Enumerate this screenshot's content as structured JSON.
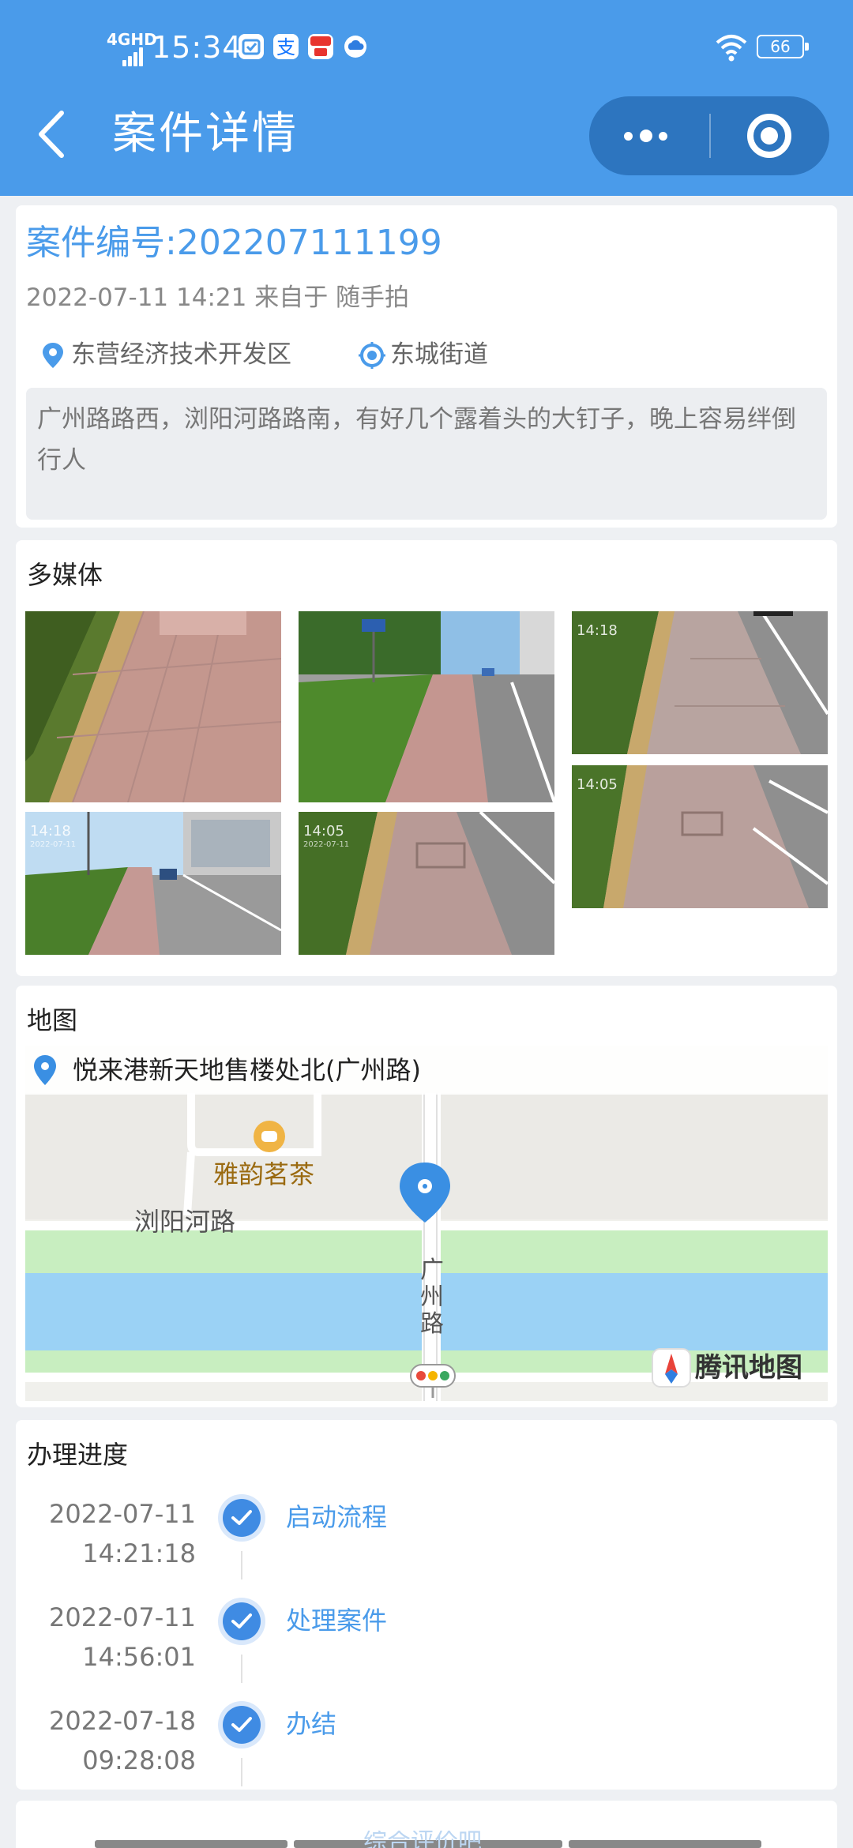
{
  "status_bar": {
    "network": "4GHD",
    "time": "15:34",
    "battery": "66"
  },
  "header": {
    "title": "案件详情"
  },
  "case": {
    "number_label": "案件编号:202207111199",
    "meta": "2022-07-11 14:21 来自于 随手拍",
    "district": "东营经济技术开发区",
    "street": "东城街道",
    "description": "广州路路西，浏阳河路路南，有好几个露着头的大钉子，晚上容易绊倒行人"
  },
  "media": {
    "title": "多媒体",
    "photos": [
      {
        "timestamp": "",
        "date": ""
      },
      {
        "timestamp": "",
        "date": ""
      },
      {
        "timestamp": "14:18",
        "date": ""
      },
      {
        "timestamp": "14:05",
        "date": ""
      },
      {
        "timestamp": "14:18",
        "date": "2022-07-11"
      },
      {
        "timestamp": "14:05",
        "date": "2022-07-11"
      }
    ]
  },
  "map": {
    "title": "地图",
    "address": "悦来港新天地售楼处北(广州路)",
    "poi_teahouse": "雅韵茗茶",
    "road_liuyanghe": "浏阳河路",
    "road_guangzhou": "广州路",
    "provider": "腾讯地图",
    "colors": {
      "water": "#9bd2f5",
      "green": "#c8eec0",
      "road": "#ffffff"
    }
  },
  "progress": {
    "title": "办理进度",
    "steps": [
      {
        "date": "2022-07-11",
        "time": "14:21:18",
        "label": "启动流程"
      },
      {
        "date": "2022-07-11",
        "time": "14:56:01",
        "label": "处理案件"
      },
      {
        "date": "2022-07-18",
        "time": "09:28:08",
        "label": "办结"
      }
    ]
  },
  "footer": {
    "button_text": "综合评价吧"
  }
}
